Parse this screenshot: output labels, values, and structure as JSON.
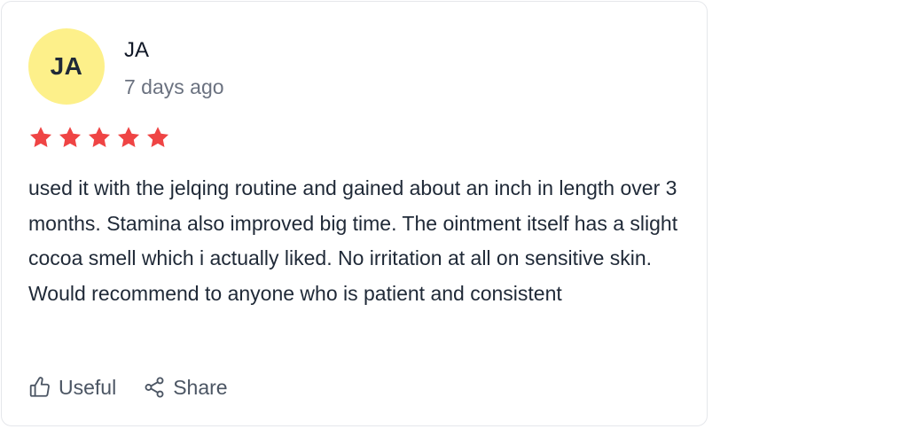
{
  "review": {
    "avatar_initials": "JA",
    "avatar_color": "#fdf08a",
    "author": "JA",
    "timestamp": "7 days ago",
    "rating": 5,
    "rating_max": 5,
    "star_color": "#ef4444",
    "text": "used it with the jelqing routine and gained about an inch in length over 3 months. Stamina also improved big time. The ointment itself has a slight cocoa smell which i actually liked. No irritation at all on sensitive skin. Would recommend to anyone who is patient and consistent"
  },
  "actions": {
    "useful_label": "Useful",
    "useful_icon": "thumbs-up-icon",
    "share_label": "Share",
    "share_icon": "share-icon"
  }
}
